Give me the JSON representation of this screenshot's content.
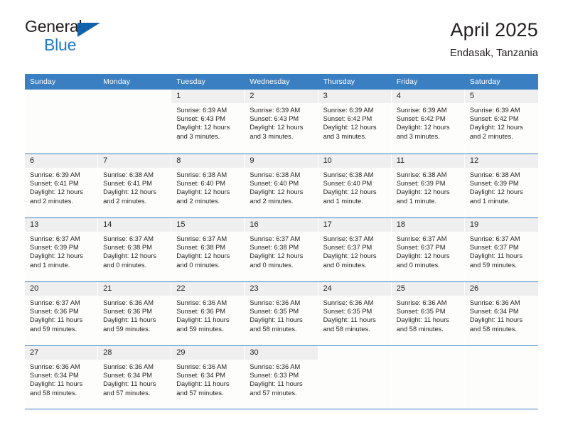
{
  "brand": {
    "name_part1": "General",
    "name_part2": "Blue",
    "flag_icon": "blue-triangle-flag"
  },
  "header": {
    "title": "April 2025",
    "subtitle": "Endasak, Tanzania"
  },
  "colors": {
    "header_blue": "#3a7fc1",
    "logo_blue": "#1f7ac4",
    "flag_blue": "#0f62ab",
    "daynum_band": "#efefef",
    "cell_background": "#fdfdfc",
    "text": "#231f20"
  },
  "weekdays": [
    "Sunday",
    "Monday",
    "Tuesday",
    "Wednesday",
    "Thursday",
    "Friday",
    "Saturday"
  ],
  "labels": {
    "sunrise_prefix": "Sunrise:",
    "sunset_prefix": "Sunset:",
    "daylight_prefix": "Daylight:"
  },
  "weeks": [
    [
      {
        "day": "",
        "blank": true
      },
      {
        "day": "",
        "blank": true
      },
      {
        "day": "1",
        "sunrise": "Sunrise: 6:39 AM",
        "sunset": "Sunset: 6:43 PM",
        "daylight1": "Daylight: 12 hours",
        "daylight2": "and 3 minutes."
      },
      {
        "day": "2",
        "sunrise": "Sunrise: 6:39 AM",
        "sunset": "Sunset: 6:43 PM",
        "daylight1": "Daylight: 12 hours",
        "daylight2": "and 3 minutes."
      },
      {
        "day": "3",
        "sunrise": "Sunrise: 6:39 AM",
        "sunset": "Sunset: 6:42 PM",
        "daylight1": "Daylight: 12 hours",
        "daylight2": "and 3 minutes."
      },
      {
        "day": "4",
        "sunrise": "Sunrise: 6:39 AM",
        "sunset": "Sunset: 6:42 PM",
        "daylight1": "Daylight: 12 hours",
        "daylight2": "and 3 minutes."
      },
      {
        "day": "5",
        "sunrise": "Sunrise: 6:39 AM",
        "sunset": "Sunset: 6:42 PM",
        "daylight1": "Daylight: 12 hours",
        "daylight2": "and 2 minutes."
      }
    ],
    [
      {
        "day": "6",
        "sunrise": "Sunrise: 6:39 AM",
        "sunset": "Sunset: 6:41 PM",
        "daylight1": "Daylight: 12 hours",
        "daylight2": "and 2 minutes."
      },
      {
        "day": "7",
        "sunrise": "Sunrise: 6:38 AM",
        "sunset": "Sunset: 6:41 PM",
        "daylight1": "Daylight: 12 hours",
        "daylight2": "and 2 minutes."
      },
      {
        "day": "8",
        "sunrise": "Sunrise: 6:38 AM",
        "sunset": "Sunset: 6:40 PM",
        "daylight1": "Daylight: 12 hours",
        "daylight2": "and 2 minutes."
      },
      {
        "day": "9",
        "sunrise": "Sunrise: 6:38 AM",
        "sunset": "Sunset: 6:40 PM",
        "daylight1": "Daylight: 12 hours",
        "daylight2": "and 2 minutes."
      },
      {
        "day": "10",
        "sunrise": "Sunrise: 6:38 AM",
        "sunset": "Sunset: 6:40 PM",
        "daylight1": "Daylight: 12 hours",
        "daylight2": "and 1 minute."
      },
      {
        "day": "11",
        "sunrise": "Sunrise: 6:38 AM",
        "sunset": "Sunset: 6:39 PM",
        "daylight1": "Daylight: 12 hours",
        "daylight2": "and 1 minute."
      },
      {
        "day": "12",
        "sunrise": "Sunrise: 6:38 AM",
        "sunset": "Sunset: 6:39 PM",
        "daylight1": "Daylight: 12 hours",
        "daylight2": "and 1 minute."
      }
    ],
    [
      {
        "day": "13",
        "sunrise": "Sunrise: 6:37 AM",
        "sunset": "Sunset: 6:39 PM",
        "daylight1": "Daylight: 12 hours",
        "daylight2": "and 1 minute."
      },
      {
        "day": "14",
        "sunrise": "Sunrise: 6:37 AM",
        "sunset": "Sunset: 6:38 PM",
        "daylight1": "Daylight: 12 hours",
        "daylight2": "and 0 minutes."
      },
      {
        "day": "15",
        "sunrise": "Sunrise: 6:37 AM",
        "sunset": "Sunset: 6:38 PM",
        "daylight1": "Daylight: 12 hours",
        "daylight2": "and 0 minutes."
      },
      {
        "day": "16",
        "sunrise": "Sunrise: 6:37 AM",
        "sunset": "Sunset: 6:38 PM",
        "daylight1": "Daylight: 12 hours",
        "daylight2": "and 0 minutes."
      },
      {
        "day": "17",
        "sunrise": "Sunrise: 6:37 AM",
        "sunset": "Sunset: 6:37 PM",
        "daylight1": "Daylight: 12 hours",
        "daylight2": "and 0 minutes."
      },
      {
        "day": "18",
        "sunrise": "Sunrise: 6:37 AM",
        "sunset": "Sunset: 6:37 PM",
        "daylight1": "Daylight: 12 hours",
        "daylight2": "and 0 minutes."
      },
      {
        "day": "19",
        "sunrise": "Sunrise: 6:37 AM",
        "sunset": "Sunset: 6:37 PM",
        "daylight1": "Daylight: 11 hours",
        "daylight2": "and 59 minutes."
      }
    ],
    [
      {
        "day": "20",
        "sunrise": "Sunrise: 6:37 AM",
        "sunset": "Sunset: 6:36 PM",
        "daylight1": "Daylight: 11 hours",
        "daylight2": "and 59 minutes."
      },
      {
        "day": "21",
        "sunrise": "Sunrise: 6:36 AM",
        "sunset": "Sunset: 6:36 PM",
        "daylight1": "Daylight: 11 hours",
        "daylight2": "and 59 minutes."
      },
      {
        "day": "22",
        "sunrise": "Sunrise: 6:36 AM",
        "sunset": "Sunset: 6:36 PM",
        "daylight1": "Daylight: 11 hours",
        "daylight2": "and 59 minutes."
      },
      {
        "day": "23",
        "sunrise": "Sunrise: 6:36 AM",
        "sunset": "Sunset: 6:35 PM",
        "daylight1": "Daylight: 11 hours",
        "daylight2": "and 58 minutes."
      },
      {
        "day": "24",
        "sunrise": "Sunrise: 6:36 AM",
        "sunset": "Sunset: 6:35 PM",
        "daylight1": "Daylight: 11 hours",
        "daylight2": "and 58 minutes."
      },
      {
        "day": "25",
        "sunrise": "Sunrise: 6:36 AM",
        "sunset": "Sunset: 6:35 PM",
        "daylight1": "Daylight: 11 hours",
        "daylight2": "and 58 minutes."
      },
      {
        "day": "26",
        "sunrise": "Sunrise: 6:36 AM",
        "sunset": "Sunset: 6:34 PM",
        "daylight1": "Daylight: 11 hours",
        "daylight2": "and 58 minutes."
      }
    ],
    [
      {
        "day": "27",
        "sunrise": "Sunrise: 6:36 AM",
        "sunset": "Sunset: 6:34 PM",
        "daylight1": "Daylight: 11 hours",
        "daylight2": "and 58 minutes."
      },
      {
        "day": "28",
        "sunrise": "Sunrise: 6:36 AM",
        "sunset": "Sunset: 6:34 PM",
        "daylight1": "Daylight: 11 hours",
        "daylight2": "and 57 minutes."
      },
      {
        "day": "29",
        "sunrise": "Sunrise: 6:36 AM",
        "sunset": "Sunset: 6:34 PM",
        "daylight1": "Daylight: 11 hours",
        "daylight2": "and 57 minutes."
      },
      {
        "day": "30",
        "sunrise": "Sunrise: 6:36 AM",
        "sunset": "Sunset: 6:33 PM",
        "daylight1": "Daylight: 11 hours",
        "daylight2": "and 57 minutes."
      },
      {
        "day": "",
        "blank": true
      },
      {
        "day": "",
        "blank": true
      },
      {
        "day": "",
        "blank": true
      }
    ]
  ]
}
